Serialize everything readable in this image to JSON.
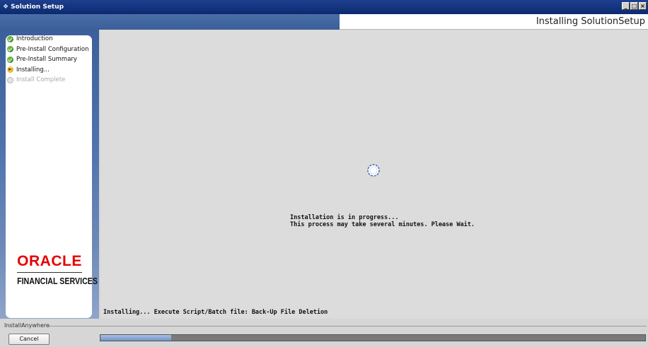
{
  "window": {
    "title": "Solution Setup",
    "controls": [
      "minimize",
      "maximize",
      "close"
    ]
  },
  "header": {
    "title": "Installing SolutionSetup"
  },
  "steps": [
    {
      "label": "Introduction",
      "status": "done"
    },
    {
      "label": "Pre-Install Configuration",
      "status": "done"
    },
    {
      "label": "Pre-Install Summary",
      "status": "done"
    },
    {
      "label": "Installing...",
      "status": "active"
    },
    {
      "label": "Install Complete",
      "status": "pending"
    }
  ],
  "logo": {
    "brand": "ORACLE",
    "subtitle": "FINANCIAL SERVICES"
  },
  "main": {
    "progress_line1": "Installation is in progress...",
    "progress_line2": "This process may take several minutes. Please Wait.",
    "status_text": "Installing... Execute Script/Batch file: Back-Up File Deletion"
  },
  "footer": {
    "brand_label": "InstallAnywhere",
    "cancel_label": "Cancel"
  },
  "progress": {
    "fraction": 0.13
  },
  "colors": {
    "accent": "#3b5f98",
    "logo_red": "#e60000",
    "step_done": "#2e8b2e",
    "step_active": "#e0a100"
  }
}
